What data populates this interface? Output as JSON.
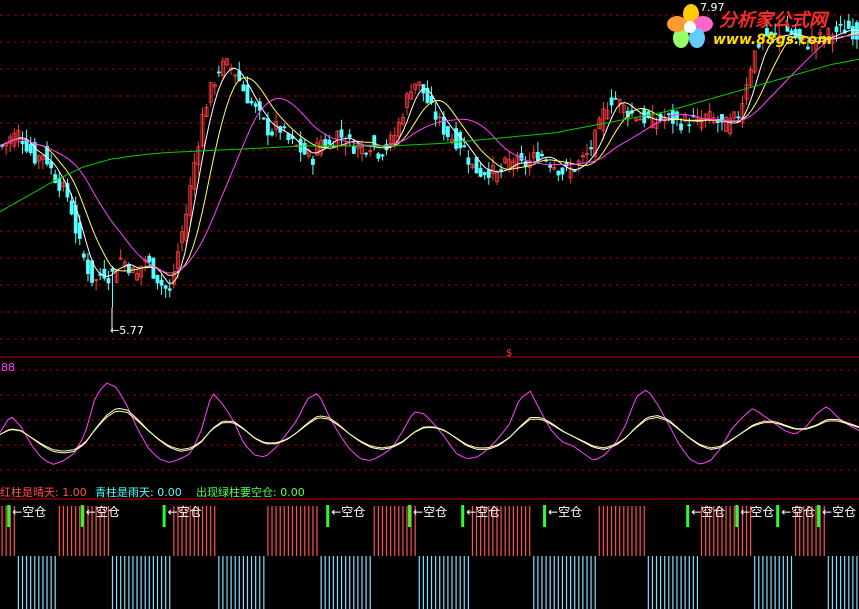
{
  "watermark": {
    "title": "分析家公式网",
    "url": "www.88gs.com"
  },
  "chart_data": [
    {
      "type": "candlestick",
      "panel": "price",
      "annotations": {
        "low_marker": "5.77",
        "high_marker": "7.97"
      },
      "colors": {
        "up": "#ff3c3c",
        "down": "#54ffff",
        "ma5": "#ffffff",
        "ma10": "#ffff66",
        "ma20": "#ff40ff",
        "ma60": "#00d000",
        "grid": "#a00000"
      },
      "closes": [
        7.0,
        7.06,
        7.1,
        7.0,
        6.9,
        6.95,
        6.8,
        6.7,
        6.6,
        6.3,
        6.1,
        5.95,
        6.05,
        6.0,
        6.15,
        6.1,
        6.0,
        6.15,
        6.05,
        5.95,
        5.88,
        6.2,
        6.5,
        6.9,
        7.25,
        7.45,
        7.6,
        7.62,
        7.55,
        7.4,
        7.3,
        7.2,
        7.1,
        7.15,
        7.05,
        7.0,
        6.95,
        6.9,
        7.05,
        7.0,
        7.1,
        7.05,
        7.0,
        6.98,
        7.02,
        6.95,
        7.0,
        7.1,
        7.3,
        7.5,
        7.45,
        7.3,
        7.2,
        7.1,
        7.05,
        7.0,
        6.85,
        6.8,
        6.82,
        6.78,
        6.85,
        6.9,
        6.85,
        6.88,
        6.95,
        6.9,
        6.85,
        6.8,
        6.82,
        6.88,
        6.95,
        7.1,
        7.3,
        7.38,
        7.3,
        7.25,
        7.22,
        7.2,
        7.18,
        7.22,
        7.2,
        7.18,
        7.2,
        7.18,
        7.22,
        7.2,
        7.15,
        7.18,
        7.25,
        7.55,
        7.75,
        7.85,
        7.82,
        7.85,
        7.88,
        7.8,
        7.78,
        7.8,
        7.83,
        7.86,
        7.88,
        7.9,
        7.85
      ],
      "ma60": [
        6.5,
        6.62,
        6.74,
        6.84,
        6.9,
        6.93,
        6.95,
        6.96,
        6.97,
        6.98,
        6.99,
        7.0,
        7.0,
        7.0,
        7.0,
        7.01,
        7.02,
        7.04,
        7.06,
        7.08,
        7.1,
        7.14,
        7.18,
        7.22,
        7.26,
        7.32,
        7.38,
        7.44,
        7.5,
        7.56,
        7.62,
        7.66
      ],
      "ylim": [
        5.6,
        8.05
      ]
    },
    {
      "type": "line",
      "panel": "oscillator",
      "label": "88",
      "series": [
        {
          "name": "fast",
          "color": "#ff40ff",
          "values": [
            42,
            60,
            48,
            28,
            14,
            8,
            12,
            20,
            40,
            80,
            95,
            90,
            70,
            45,
            25,
            14,
            10,
            14,
            20,
            45,
            85,
            72,
            55,
            30,
            18,
            16,
            26,
            40,
            55,
            78,
            84,
            60,
            40,
            24,
            14,
            12,
            18,
            26,
            44,
            64,
            62,
            50,
            36,
            20,
            14,
            16,
            24,
            36,
            50,
            78,
            86,
            64,
            44,
            32,
            28,
            20,
            12,
            18,
            30,
            50,
            80,
            88,
            72,
            52,
            30,
            14,
            8,
            12,
            26,
            46,
            58,
            68,
            60,
            52,
            44,
            40,
            48,
            62,
            70,
            58,
            50,
            44
          ]
        },
        {
          "name": "slow",
          "color": "#ffffe0",
          "values": [
            40,
            46,
            44,
            36,
            28,
            22,
            20,
            22,
            30,
            46,
            60,
            68,
            66,
            56,
            44,
            34,
            26,
            22,
            24,
            32,
            46,
            54,
            54,
            46,
            36,
            30,
            30,
            34,
            42,
            52,
            60,
            58,
            50,
            40,
            32,
            26,
            24,
            26,
            32,
            42,
            48,
            48,
            44,
            36,
            28,
            24,
            24,
            28,
            36,
            48,
            58,
            58,
            52,
            44,
            38,
            32,
            26,
            24,
            28,
            36,
            48,
            58,
            60,
            56,
            46,
            36,
            28,
            24,
            26,
            34,
            42,
            50,
            54,
            54,
            50,
            46,
            46,
            50,
            56,
            56,
            52,
            48
          ]
        }
      ]
    },
    {
      "type": "bar",
      "panel": "signal",
      "legend": [
        {
          "text": "红柱是晴天: 1.00",
          "color": "#ff5050"
        },
        {
          "text": "青柱是雨天: 0.00",
          "color": "#54ffff"
        },
        {
          "text": "出现绿柱要空仓: 0.00",
          "color": "#54ff54"
        }
      ],
      "signal_label": "←空仓",
      "signals_bar_index": [
        2,
        20,
        40,
        80,
        100,
        113,
        133,
        168,
        180,
        190,
        200
      ]
    }
  ]
}
